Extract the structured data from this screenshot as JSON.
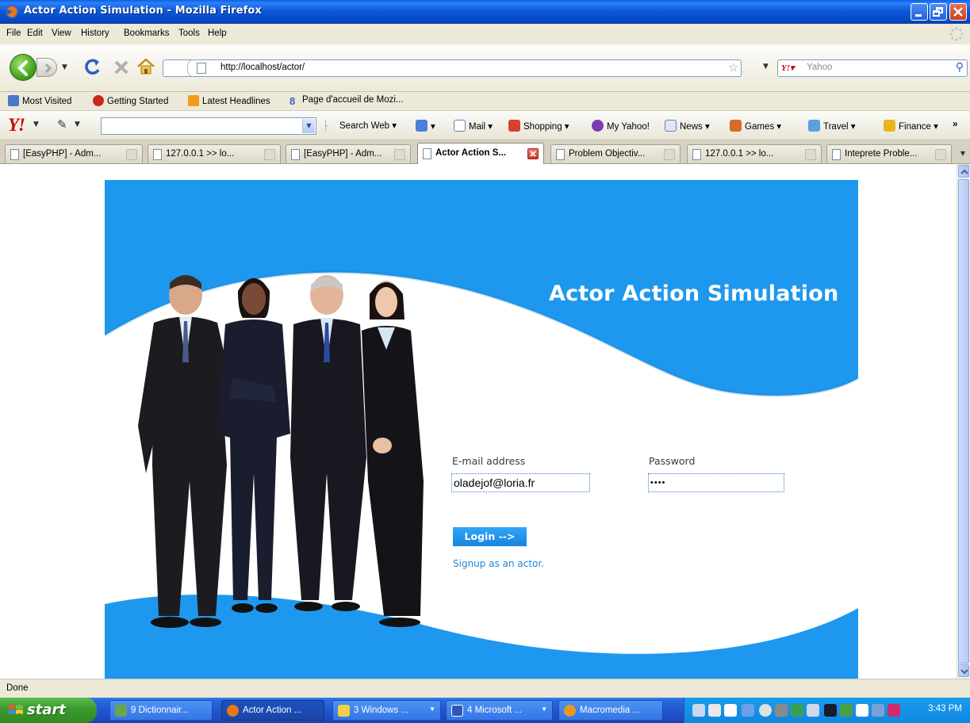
{
  "window": {
    "title": "Actor Action Simulation - Mozilla Firefox"
  },
  "menu": [
    "File",
    "Edit",
    "View",
    "History",
    "Bookmarks",
    "Tools",
    "Help"
  ],
  "nav": {
    "url": "http://localhost/actor/",
    "search_engine": "Yahoo"
  },
  "bookmarks": [
    {
      "label": "Most Visited",
      "icon": "most-visited-icon"
    },
    {
      "label": "Getting Started",
      "icon": "getting-started-icon"
    },
    {
      "label": "Latest Headlines",
      "icon": "rss-icon"
    },
    {
      "label": "Page d'accueil de Mozi...",
      "icon": "mozilla-icon"
    }
  ],
  "yahoo_toolbar": {
    "search_web": "Search Web",
    "buttons": [
      {
        "label": "Mail",
        "icon": "mail-icon"
      },
      {
        "label": "Shopping",
        "icon": "shopping-icon"
      },
      {
        "label": "My Yahoo!",
        "icon": "my-yahoo-icon"
      },
      {
        "label": "News",
        "icon": "news-icon"
      },
      {
        "label": "Games",
        "icon": "games-icon"
      },
      {
        "label": "Travel",
        "icon": "travel-icon"
      },
      {
        "label": "Finance",
        "icon": "finance-icon"
      }
    ],
    "overflow": "»"
  },
  "tabs": [
    {
      "label": "[EasyPHP] - Adm...",
      "active": false
    },
    {
      "label": "127.0.0.1 >> lo...",
      "active": false
    },
    {
      "label": "[EasyPHP] - Adm...",
      "active": false
    },
    {
      "label": "Actor Action S...",
      "active": true
    },
    {
      "label": "Problem Objectiv...",
      "active": false
    },
    {
      "label": "127.0.0.1 >> lo...",
      "active": false
    },
    {
      "label": "Inteprete Proble...",
      "active": false
    }
  ],
  "page": {
    "title": "Actor Action Simulation",
    "email_label": "E-mail address",
    "email_value": "oladejof@loria.fr",
    "password_label": "Password",
    "password_value": "••••",
    "login_button": "Login  -->",
    "signup_link": "Signup as an actor."
  },
  "status": {
    "text": "Done"
  },
  "taskbar": {
    "start": "start",
    "tasks": [
      {
        "label": "9 Dictionnair...",
        "icon": "dictionary-icon",
        "active": false,
        "has_caret": false
      },
      {
        "label": "Actor Action ...",
        "icon": "firefox-icon",
        "active": true,
        "has_caret": false
      },
      {
        "label": "3 Windows ...",
        "icon": "folder-icon",
        "active": false,
        "has_caret": true
      },
      {
        "label": "4 Microsoft ...",
        "icon": "word-icon",
        "active": false,
        "has_caret": true
      },
      {
        "label": "Macromedia ...",
        "icon": "macromedia-icon",
        "active": false,
        "has_caret": false
      }
    ],
    "clock": "3:43 PM"
  },
  "colors": {
    "brand_blue": "#1e98ee",
    "xp_titlebar": "#0448c8",
    "xp_start_green": "#3c9b2f"
  }
}
